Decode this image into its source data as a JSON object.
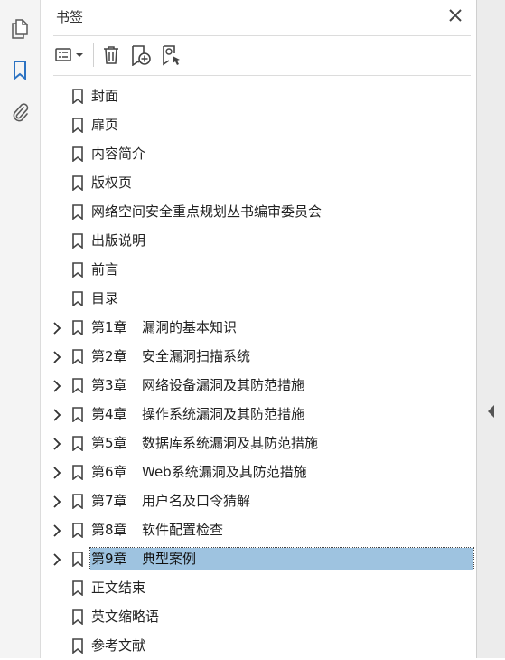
{
  "panel": {
    "title": "书签",
    "selected_index": 17,
    "colors": {
      "selection_bg": "#9ec3e0",
      "accent": "#2b72c2"
    }
  },
  "rail": {
    "items": [
      {
        "icon": "pages-icon"
      },
      {
        "icon": "bookmark-icon",
        "active": true
      },
      {
        "icon": "paperclip-icon"
      }
    ]
  },
  "toolbar": {
    "buttons": [
      {
        "icon": "options-menu-icon"
      },
      {
        "icon": "trash-icon"
      },
      {
        "icon": "new-bookmark-icon"
      },
      {
        "icon": "find-bookmark-icon"
      }
    ]
  },
  "bookmarks": [
    {
      "chapter": "",
      "title": "封面",
      "expandable": false
    },
    {
      "chapter": "",
      "title": "扉页",
      "expandable": false
    },
    {
      "chapter": "",
      "title": "内容简介",
      "expandable": false
    },
    {
      "chapter": "",
      "title": "版权页",
      "expandable": false
    },
    {
      "chapter": "",
      "title": "网络空间安全重点规划丛书编审委员会",
      "expandable": false
    },
    {
      "chapter": "",
      "title": "出版说明",
      "expandable": false
    },
    {
      "chapter": "",
      "title": "前言",
      "expandable": false
    },
    {
      "chapter": "",
      "title": "目录",
      "expandable": false
    },
    {
      "chapter": "第1章",
      "title": "漏洞的基本知识",
      "expandable": true
    },
    {
      "chapter": "第2章",
      "title": "安全漏洞扫描系统",
      "expandable": true
    },
    {
      "chapter": "第3章",
      "title": "网络设备漏洞及其防范措施",
      "expandable": true
    },
    {
      "chapter": "第4章",
      "title": "操作系统漏洞及其防范措施",
      "expandable": true
    },
    {
      "chapter": "第5章",
      "title": "数据库系统漏洞及其防范措施",
      "expandable": true
    },
    {
      "chapter": "第6章",
      "title": "Web系统漏洞及其防范措施",
      "expandable": true
    },
    {
      "chapter": "第7章",
      "title": "用户名及口令猜解",
      "expandable": true
    },
    {
      "chapter": "第8章",
      "title": "软件配置检查",
      "expandable": true
    },
    {
      "chapter": "第9章",
      "title": "典型案例",
      "expandable": true,
      "selected": true
    },
    {
      "chapter": "",
      "title": "正文结束",
      "expandable": false
    },
    {
      "chapter": "",
      "title": "英文缩略语",
      "expandable": false
    },
    {
      "chapter": "",
      "title": "参考文献",
      "expandable": false
    }
  ]
}
